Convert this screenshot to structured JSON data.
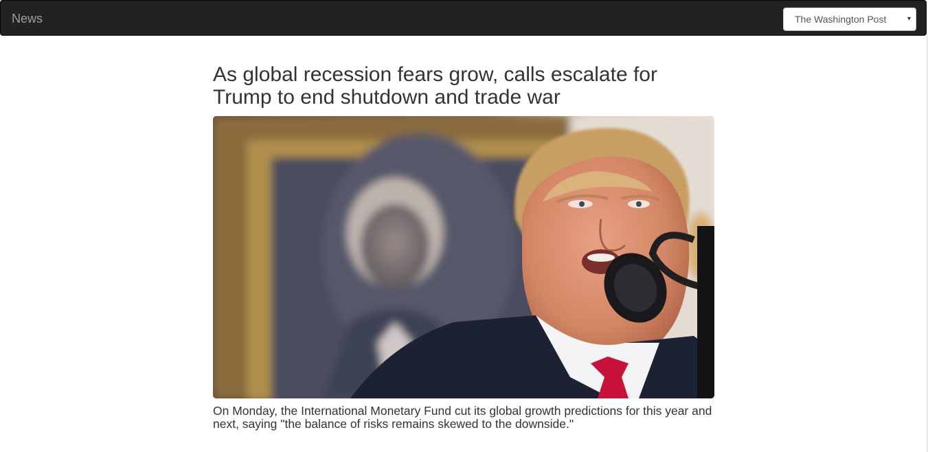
{
  "navbar": {
    "brand": "News",
    "source_select": {
      "selected": "The Washington Post"
    }
  },
  "article": {
    "headline": "As global recession fears grow, calls escalate for Trump to end shutdown and trade war",
    "image_icon": "news-photo",
    "summary": "On Monday, the International Monetary Fund cut its global growth predictions for this year and next, saying \"the balance of risks remains skewed to the downside.\""
  },
  "colors": {
    "navbar_bg": "#222222",
    "brand_text": "#9d9d9d",
    "body_text": "#333333"
  }
}
